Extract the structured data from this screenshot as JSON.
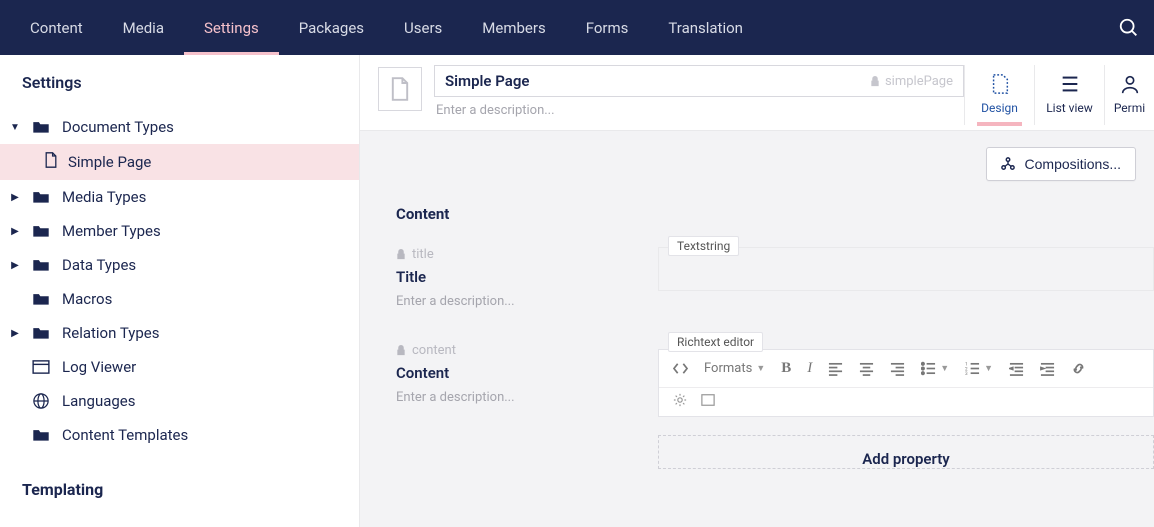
{
  "topnav": {
    "items": [
      "Content",
      "Media",
      "Settings",
      "Packages",
      "Users",
      "Members",
      "Forms",
      "Translation"
    ],
    "active_index": 2
  },
  "sidebar": {
    "title": "Settings",
    "tree": [
      {
        "label": "Document Types",
        "icon": "folder",
        "expandable": true,
        "expanded": true,
        "children": [
          {
            "label": "Simple Page",
            "icon": "file",
            "active": true
          }
        ]
      },
      {
        "label": "Media Types",
        "icon": "folder",
        "expandable": true
      },
      {
        "label": "Member Types",
        "icon": "folder",
        "expandable": true
      },
      {
        "label": "Data Types",
        "icon": "folder",
        "expandable": true
      },
      {
        "label": "Macros",
        "icon": "folder",
        "expandable": false
      },
      {
        "label": "Relation Types",
        "icon": "folder",
        "expandable": true
      },
      {
        "label": "Log Viewer",
        "icon": "log",
        "expandable": false
      },
      {
        "label": "Languages",
        "icon": "globe",
        "expandable": false
      },
      {
        "label": "Content Templates",
        "icon": "folder",
        "expandable": false
      }
    ],
    "section2_title": "Templating"
  },
  "doc": {
    "name": "Simple Page",
    "alias": "simplePage",
    "description_placeholder": "Enter a description...",
    "tabs": [
      {
        "label": "Design",
        "icon": "design",
        "active": true
      },
      {
        "label": "List view",
        "icon": "listview"
      },
      {
        "label": "Permi",
        "icon": "permissions"
      }
    ],
    "compositions_label": "Compositions...",
    "group_title": "Content",
    "properties": [
      {
        "alias": "title",
        "label": "Title",
        "editor": "Textstring",
        "desc_placeholder": "Enter a description..."
      },
      {
        "alias": "content",
        "label": "Content",
        "editor": "Richtext editor",
        "desc_placeholder": "Enter a description..."
      }
    ],
    "rte": {
      "formats_label": "Formats"
    },
    "add_property_label": "Add property"
  }
}
